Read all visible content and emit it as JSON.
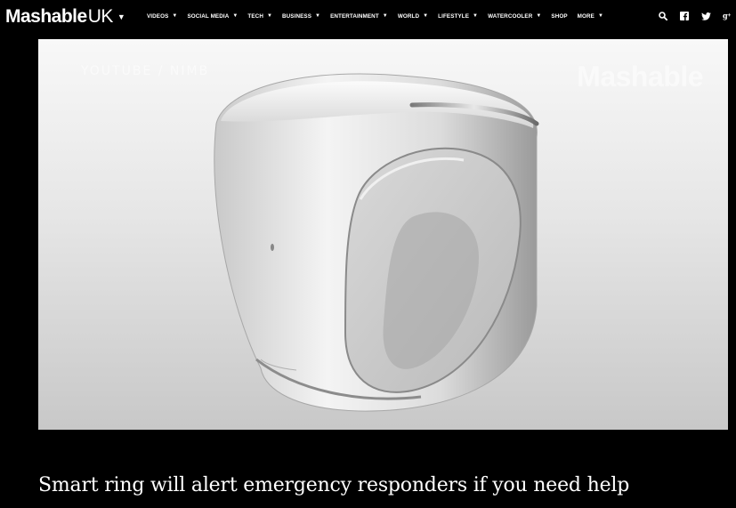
{
  "site": {
    "brand": "Mashable",
    "region": "UK",
    "brand_caret": "▼"
  },
  "nav": {
    "items": [
      {
        "label": "VIDEOS",
        "has_dropdown": true
      },
      {
        "label": "SOCIAL MEDIA",
        "has_dropdown": true
      },
      {
        "label": "TECH",
        "has_dropdown": true
      },
      {
        "label": "BUSINESS",
        "has_dropdown": true
      },
      {
        "label": "ENTERTAINMENT",
        "has_dropdown": true
      },
      {
        "label": "WORLD",
        "has_dropdown": true
      },
      {
        "label": "LIFESTYLE",
        "has_dropdown": true
      },
      {
        "label": "WATERCOOLER",
        "has_dropdown": true
      },
      {
        "label": "SHOP",
        "has_dropdown": false
      },
      {
        "label": "MORE",
        "has_dropdown": true
      }
    ],
    "caret": "▼",
    "icons": [
      "search-icon",
      "facebook-icon",
      "twitter-icon",
      "google-plus-icon"
    ]
  },
  "hero": {
    "credit": "YOUTUBE / NIMB",
    "watermark": "Mashable"
  },
  "article": {
    "headline": "Smart ring will alert emergency responders if you need help"
  },
  "colors": {
    "page_background": "#000000",
    "text": "#ffffff",
    "hero_light": "#f8f8f8",
    "hero_dark": "#c8c8c8"
  }
}
